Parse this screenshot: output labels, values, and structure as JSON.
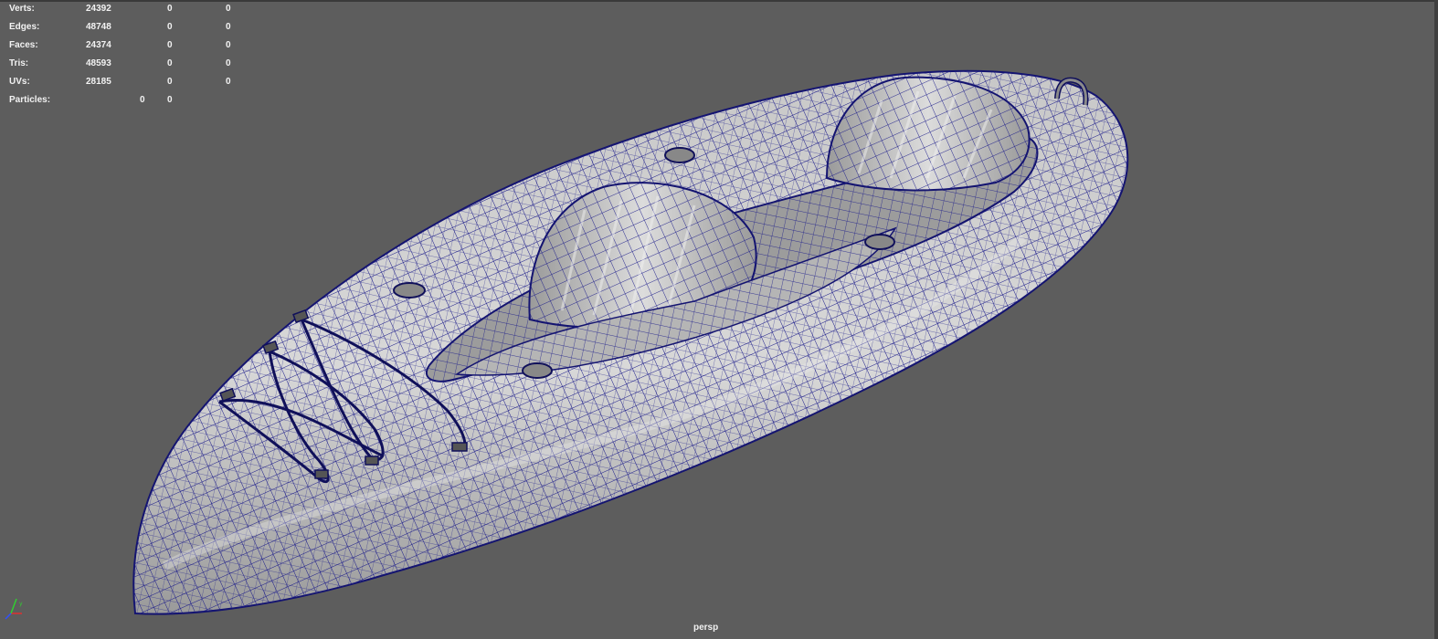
{
  "hud": {
    "rows": [
      {
        "label": "Verts:",
        "v1": "24392",
        "v2": "0",
        "v3": "0"
      },
      {
        "label": "Edges:",
        "v1": "48748",
        "v2": "0",
        "v3": "0"
      },
      {
        "label": "Faces:",
        "v1": "24374",
        "v2": "0",
        "v3": "0"
      },
      {
        "label": "Tris:",
        "v1": "48593",
        "v2": "0",
        "v3": "0"
      },
      {
        "label": "UVs:",
        "v1": "28185",
        "v2": "0",
        "v3": "0"
      }
    ],
    "particles": {
      "label": "Particles:",
      "v2": "0",
      "v3": "0"
    }
  },
  "viewport": {
    "camera": "persp",
    "background": "#5d5d5d",
    "wireframe_color": "#1a1a8a",
    "shaded_color": "#b8b8b8",
    "model_icon": "kayak-wireframe-mesh"
  },
  "axis_gizmo": {
    "icon": "axis-gizmo-icon",
    "x_color": "#e03030",
    "y_color": "#30d030",
    "z_color": "#3050ff"
  }
}
